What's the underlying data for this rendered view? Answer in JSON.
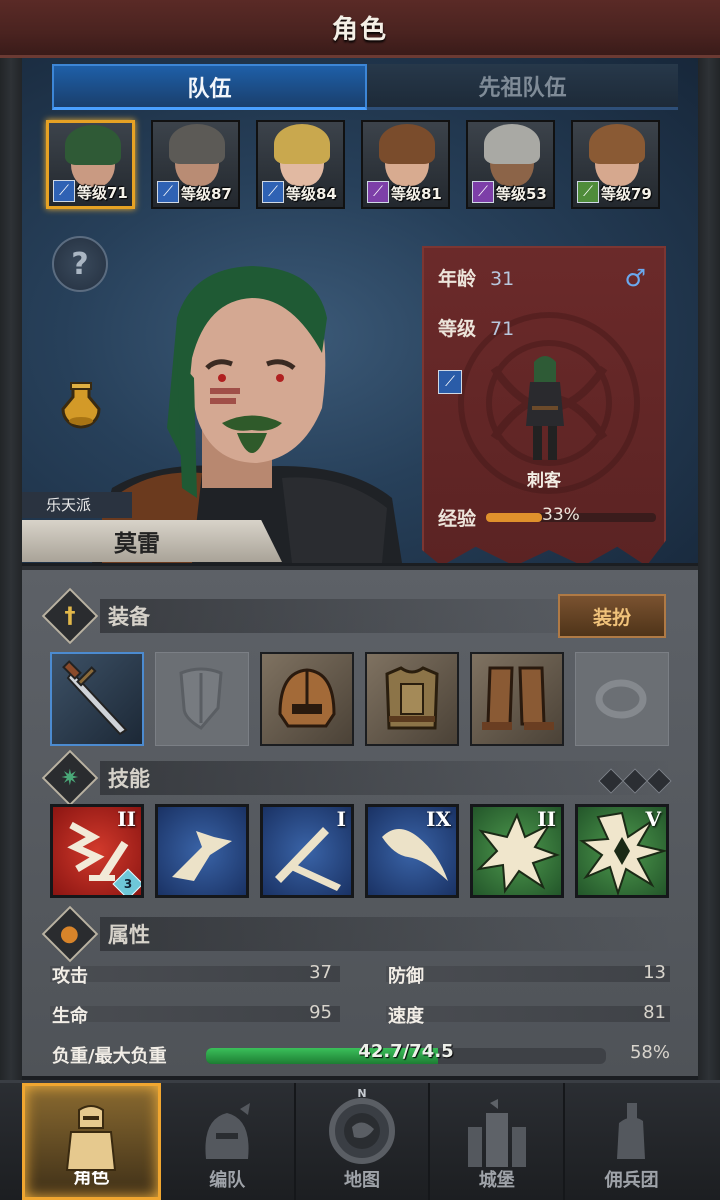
{
  "header": {
    "title": "角色"
  },
  "tabs": [
    {
      "label": "队伍"
    },
    {
      "label": "先祖队伍"
    }
  ],
  "roster": [
    {
      "level_text": "等级71",
      "class_color": "#2f62b4",
      "hair": "#2f5a36",
      "skin": "#c99a82",
      "class_icon": "sword-class-icon"
    },
    {
      "level_text": "等级87",
      "class_color": "#2f62b4",
      "hair": "#5c5a56",
      "skin": "#b98c74",
      "class_icon": "sword-class-icon"
    },
    {
      "level_text": "等级84",
      "class_color": "#2f62b4",
      "hair": "#c9a84e",
      "skin": "#e1b9a2",
      "class_icon": "sword-class-icon"
    },
    {
      "level_text": "等级81",
      "class_color": "#7d3fa8",
      "hair": "#7a4c2c",
      "skin": "#d8ab90",
      "class_icon": "staff-class-icon"
    },
    {
      "level_text": "等级53",
      "class_color": "#7d3fa8",
      "hair": "#a9a9a4",
      "skin": "#8c6448",
      "class_icon": "staff-class-icon"
    },
    {
      "level_text": "等级79",
      "class_color": "#4f8c3a",
      "hair": "#8a5a34",
      "skin": "#d6a88e",
      "class_icon": "crossed-class-icon"
    }
  ],
  "hero": {
    "faction": "乐天派",
    "name": "莫雷",
    "age_label": "年龄",
    "age": "31",
    "level_label": "等级",
    "level": "71",
    "gender_symbol": "♂",
    "class_name": "刺客",
    "xp_label": "经验",
    "xp_percent_text": "33%",
    "xp_fraction": 0.33
  },
  "equipment": {
    "title": "装备",
    "dress_button": "装扮",
    "slots": [
      {
        "name": "dagger-icon",
        "state": "equipped"
      },
      {
        "name": "shield-icon",
        "state": "empty"
      },
      {
        "name": "helmet-icon",
        "state": "equipped"
      },
      {
        "name": "chest-armor-icon",
        "state": "equipped"
      },
      {
        "name": "boots-icon",
        "state": "equipped"
      },
      {
        "name": "ring-icon",
        "state": "empty"
      }
    ]
  },
  "skills": {
    "title": "技能",
    "items": [
      {
        "rank": "II",
        "color": "red",
        "sub": "3"
      },
      {
        "rank": "",
        "color": "blue"
      },
      {
        "rank": "I",
        "color": "blue"
      },
      {
        "rank": "IX",
        "color": "blue"
      },
      {
        "rank": "II",
        "color": "green"
      },
      {
        "rank": "V",
        "color": "green"
      }
    ]
  },
  "attributes": {
    "title": "属性",
    "attack_label": "攻击",
    "attack": "37",
    "defense_label": "防御",
    "defense": "13",
    "hp_label": "生命",
    "hp": "95",
    "speed_label": "速度",
    "speed": "81",
    "load_label": "负重/最大负重",
    "load_text": "42.7/74.5",
    "load_percent": "58%",
    "load_fraction": 0.58
  },
  "nav": [
    {
      "label": "角色"
    },
    {
      "label": "编队"
    },
    {
      "label": "地图",
      "compass": "N"
    },
    {
      "label": "城堡"
    },
    {
      "label": "佣兵团"
    }
  ]
}
